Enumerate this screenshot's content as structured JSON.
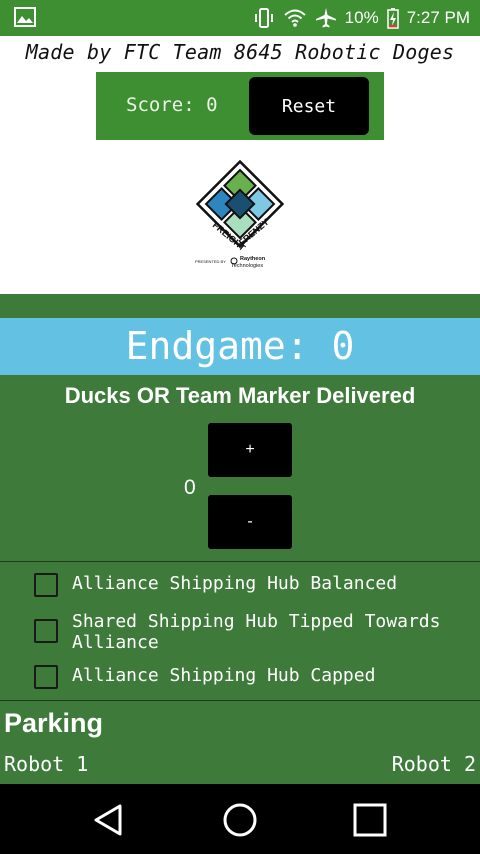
{
  "status_bar": {
    "battery_percent": "10%",
    "time": "7:27 PM",
    "icons": [
      "image-notification-icon",
      "vibrate-icon",
      "wifi-icon",
      "airplane-icon",
      "battery-charging-icon"
    ]
  },
  "header": {
    "credit": "Made by FTC Team 8645 Robotic Doges"
  },
  "score_panel": {
    "score_text": "Score: 0",
    "reset_label": "Reset"
  },
  "logo": {
    "name": "freight-frenzy-logo",
    "text_main": "FREIGHT FRENZY",
    "text_sub": "Raytheon Technologies"
  },
  "endgame": {
    "title": "Endgame: 0",
    "ducks_title": "Ducks OR Team Marker Delivered",
    "ducks_count": "0",
    "plus_label": "+",
    "minus_label": "-",
    "checks": [
      {
        "label": "Alliance Shipping Hub Balanced",
        "checked": false
      },
      {
        "label": "Shared Shipping Hub Tipped Towards Alliance",
        "checked": false
      },
      {
        "label": "Alliance Shipping Hub Capped",
        "checked": false
      }
    ]
  },
  "parking": {
    "title": "Parking",
    "robot1": "Robot 1",
    "robot2": "Robot 2"
  },
  "colors": {
    "status_green": "#3e8f31",
    "panel_green": "#3e7b3a",
    "band_blue": "#63c1e3"
  }
}
